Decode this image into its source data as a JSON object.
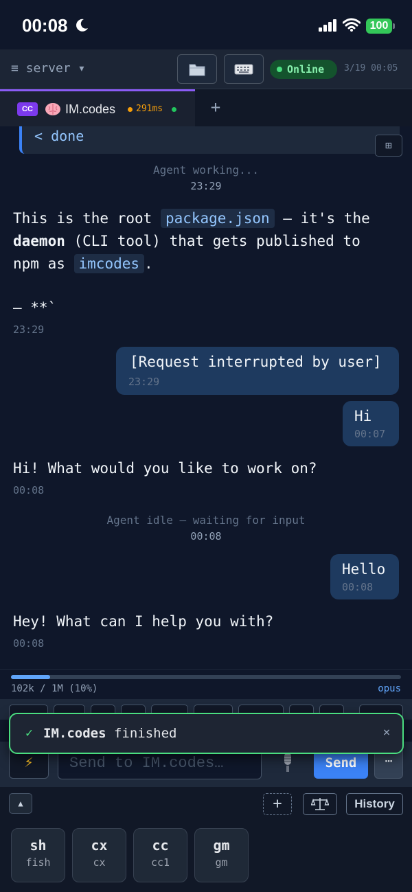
{
  "status_bar": {
    "time": "00:08",
    "battery": "100"
  },
  "toolbar": {
    "server_label": "≡ server ▾",
    "files_icon": "folder-icon",
    "keyboard_icon": "keyboard-icon",
    "online_label": "Online",
    "timestamp": "3/19 00:05"
  },
  "tab": {
    "badge": "CC",
    "title": "IM.codes",
    "latency": "291ms",
    "add_label": "+"
  },
  "chat": {
    "tool_output": "< done",
    "expand_icon": "⊞",
    "working_status": "Agent working...",
    "working_time": "23:29",
    "reply1_pre": "This is the root ",
    "reply1_code1": "package.json",
    "reply1_mid": " — it's the",
    "reply1_bold": "daemon",
    "reply1_line2_rest": " (CLI tool) that gets published to",
    "reply1_line3_pre": "npm as ",
    "reply1_code2": "imcodes",
    "reply1_line3_post": ".",
    "reply1_line4": "— **`",
    "reply1_time": "23:29",
    "user1_text": "[Request interrupted by user]",
    "user1_time": "23:29",
    "user2_text": "Hi",
    "user2_time": "00:07",
    "reply2_text": "Hi! What would you like to work on?",
    "reply2_time": "00:08",
    "idle_status": "Agent idle — waiting for input",
    "idle_time": "00:08",
    "user3_text": "Hello",
    "user3_time": "00:08",
    "reply3_text": "Hey! What can I help you with?",
    "reply3_time": "00:08"
  },
  "context": {
    "usage": "102k / 1M (10%)",
    "fraction": 0.1,
    "model": "opus"
  },
  "composer": {
    "placeholder": "Send to IM.codes…",
    "lightning": "⚡",
    "send_label": "Send",
    "more_label": "⋯"
  },
  "toast": {
    "check": "✓",
    "app": "IM.codes",
    "message": " finished",
    "close": "×"
  },
  "bottom": {
    "collapse": "▲",
    "new_session": "+",
    "history_label": "History",
    "sessions": [
      {
        "short": "sh",
        "name": "fish"
      },
      {
        "short": "cx",
        "name": "cx"
      },
      {
        "short": "cc",
        "name": "cc1"
      },
      {
        "short": "gm",
        "name": "gm"
      }
    ]
  },
  "colors": {
    "accent": "#8b5cf6",
    "online": "#4ade80",
    "send": "#3b82f6",
    "bubble": "#1e3a5f",
    "background": "#0f172a"
  }
}
